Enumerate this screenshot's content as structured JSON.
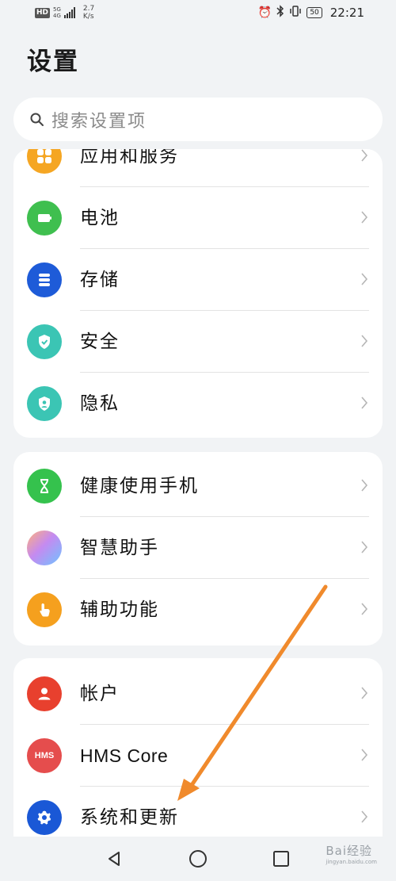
{
  "status_bar": {
    "hd": "HD",
    "network_top": "5G",
    "network_bottom": "4G",
    "speed_value": "2.7",
    "speed_unit": "K/s",
    "battery": "50",
    "time": "22:21"
  },
  "page": {
    "title": "设置"
  },
  "search": {
    "placeholder": "搜索设置项"
  },
  "groups": [
    {
      "items": [
        {
          "label": "应用和服务",
          "icon": "apps-icon",
          "color": "#f5a623"
        },
        {
          "label": "电池",
          "icon": "battery-icon",
          "color": "#3fbf4f"
        },
        {
          "label": "存储",
          "icon": "storage-icon",
          "color": "#1e5bd8"
        },
        {
          "label": "安全",
          "icon": "shield-check-icon",
          "color": "#3bc5b4"
        },
        {
          "label": "隐私",
          "icon": "privacy-shield-icon",
          "color": "#3bc5b4"
        }
      ]
    },
    {
      "items": [
        {
          "label": "健康使用手机",
          "icon": "hourglass-icon",
          "color": "#35c24d"
        },
        {
          "label": "智慧助手",
          "icon": "assistant-orb-icon",
          "color": "#c58af0"
        },
        {
          "label": "辅助功能",
          "icon": "hand-pointer-icon",
          "color": "#f5a01e"
        }
      ]
    },
    {
      "items": [
        {
          "label": "帐户",
          "icon": "person-icon",
          "color": "#e8402e"
        },
        {
          "label": "HMS Core",
          "icon": "hms-icon",
          "icon_text": "HMS",
          "color": "#e54d4d"
        },
        {
          "label": "系统和更新",
          "icon": "gear-icon",
          "color": "#1a58d6"
        }
      ]
    }
  ],
  "annotation": {
    "arrow_color": "#f08a2c"
  },
  "watermark": {
    "text": "Bai经验",
    "subtext": "jingyan.baidu.com"
  }
}
